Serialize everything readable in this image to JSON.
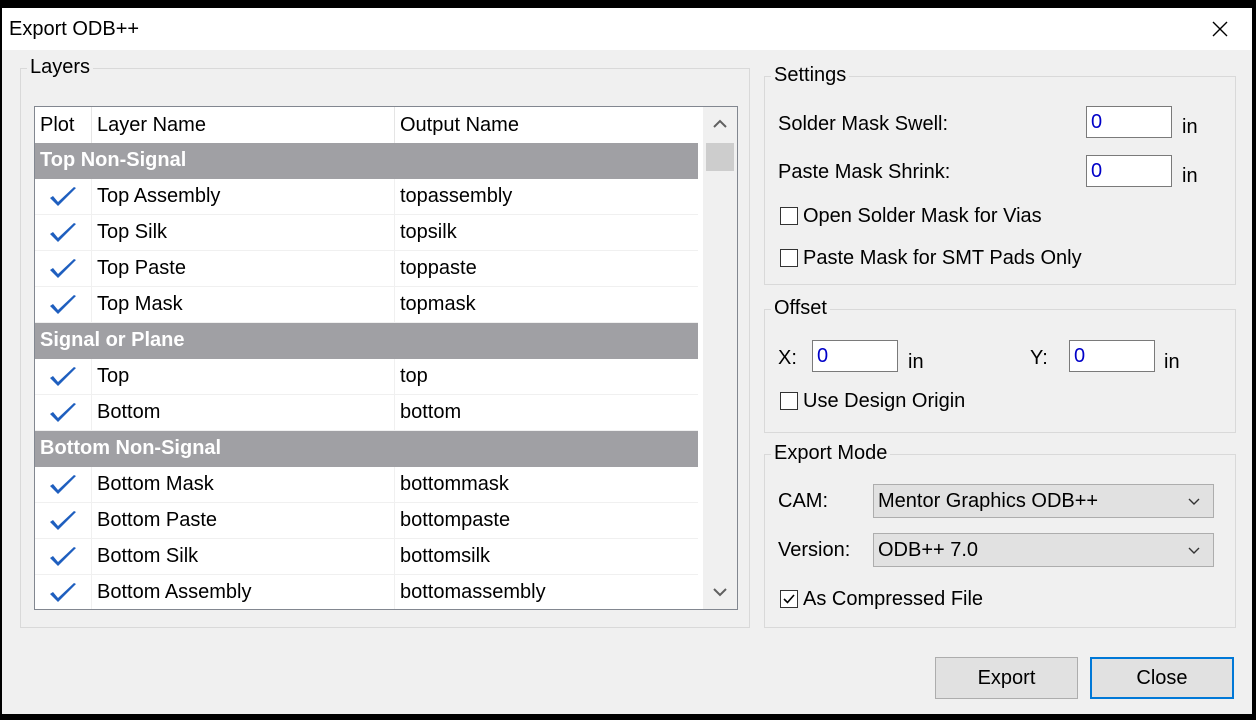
{
  "window": {
    "title": "Export ODB++"
  },
  "layers": {
    "group_title": "Layers",
    "columns": {
      "plot": "Plot",
      "layer_name": "Layer Name",
      "output_name": "Output Name"
    },
    "groups": [
      {
        "name": "Top Non-Signal",
        "rows": [
          {
            "plot": true,
            "layer": "Top Assembly",
            "output": "topassembly"
          },
          {
            "plot": true,
            "layer": "Top Silk",
            "output": "topsilk"
          },
          {
            "plot": true,
            "layer": "Top Paste",
            "output": "toppaste"
          },
          {
            "plot": true,
            "layer": "Top Mask",
            "output": "topmask"
          }
        ]
      },
      {
        "name": "Signal or Plane",
        "rows": [
          {
            "plot": true,
            "layer": "Top",
            "output": "top"
          },
          {
            "plot": true,
            "layer": "Bottom",
            "output": "bottom"
          }
        ]
      },
      {
        "name": "Bottom Non-Signal",
        "rows": [
          {
            "plot": true,
            "layer": "Bottom Mask",
            "output": "bottommask"
          },
          {
            "plot": true,
            "layer": "Bottom Paste",
            "output": "bottompaste"
          },
          {
            "plot": true,
            "layer": "Bottom Silk",
            "output": "bottomsilk"
          },
          {
            "plot": true,
            "layer": "Bottom Assembly",
            "output": "bottomassembly"
          }
        ]
      }
    ]
  },
  "settings": {
    "group_title": "Settings",
    "solder_mask_swell_label": "Solder Mask Swell:",
    "solder_mask_swell_value": "0",
    "paste_mask_shrink_label": "Paste Mask Shrink:",
    "paste_mask_shrink_value": "0",
    "unit": "in",
    "open_solder_mask_label": "Open Solder Mask for Vias",
    "open_solder_mask_checked": false,
    "paste_mask_smt_label": "Paste Mask for SMT Pads Only",
    "paste_mask_smt_checked": false
  },
  "offset": {
    "group_title": "Offset",
    "x_label": "X:",
    "x_value": "0",
    "y_label": "Y:",
    "y_value": "0",
    "unit": "in",
    "use_design_origin_label": "Use Design Origin",
    "use_design_origin_checked": false
  },
  "export_mode": {
    "group_title": "Export Mode",
    "cam_label": "CAM:",
    "cam_value": "Mentor Graphics ODB++",
    "version_label": "Version:",
    "version_value": "ODB++ 7.0",
    "compressed_label": "As Compressed File",
    "compressed_checked": true
  },
  "buttons": {
    "export": "Export",
    "close": "Close"
  },
  "colors": {
    "check": "#1f5fbf",
    "group_header": "#a0a0a4",
    "accent": "#0078d7",
    "input_text": "#0000c8"
  }
}
